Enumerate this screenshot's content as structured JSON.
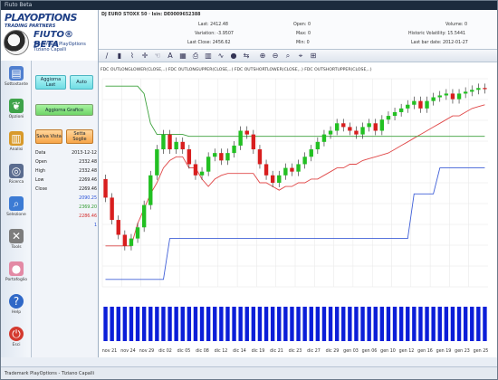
{
  "window": {
    "title": "Fiuto Beta"
  },
  "brand": {
    "line1": "PLAYOPTIONS",
    "line2": "TRADING PARTNERS",
    "line3": "FIUTO® BETA",
    "line4": "Trademark PlayOptions",
    "line5": "Tiziano Capalli"
  },
  "sidebar": {
    "items": [
      {
        "label": "Sottostante",
        "icon": "chart-bars-icon",
        "color": "#4f7fcf"
      },
      {
        "label": "Opzioni",
        "icon": "leaf-icon",
        "color": "#3ea34a"
      },
      {
        "label": "Analisi",
        "icon": "bar-chart-icon",
        "color": "#d89a2a"
      },
      {
        "label": "Ricerca",
        "icon": "binoculars-icon",
        "color": "#5a6c8f"
      },
      {
        "label": "Selezione",
        "icon": "magnifier-icon",
        "color": "#3c7bd4"
      },
      {
        "label": "Tools",
        "icon": "tools-icon",
        "color": "#7d7d7d"
      },
      {
        "label": "Portafoglio",
        "icon": "piggy-bank-icon",
        "color": "#e38aa5"
      },
      {
        "label": "Help",
        "icon": "help-icon",
        "color": "#2f68c7"
      },
      {
        "label": "Esci",
        "icon": "exit-icon",
        "color": "#d43a2f"
      }
    ]
  },
  "panel": {
    "btn_aggiorna_last": "Aggiorna Last",
    "btn_auto": "Auto",
    "btn_aggiorna_grafico": "Aggiorna Grafico",
    "btn_salva_vista": "Salva Vista",
    "btn_setta_soglie": "Setta Soglie",
    "stats": [
      {
        "label": "Data",
        "value": "2013-12-12",
        "color": "#222222"
      },
      {
        "label": "Open",
        "value": "2332.48",
        "color": "#222222"
      },
      {
        "label": "High",
        "value": "2332.48",
        "color": "#222222"
      },
      {
        "label": "Low",
        "value": "2269.46",
        "color": "#222222"
      },
      {
        "label": "Close",
        "value": "2269.46",
        "color": "#222222"
      },
      {
        "label": "",
        "value": "2090.25",
        "color": "#2850d8"
      },
      {
        "label": "",
        "value": "2369.20",
        "color": "#2e9a2e"
      },
      {
        "label": "",
        "value": "2286.46",
        "color": "#d42a2a"
      },
      {
        "label": "",
        "value": "1",
        "color": "#2850d8"
      }
    ]
  },
  "info": {
    "name": "DJ EURO STOXX 50 · Isin: DE0009652388",
    "last": "Last: 2412.48",
    "variation": "Variation: -3.9507",
    "last_close": "Last Close: 2456.62",
    "open": "Open: 0",
    "max": "Max: 0",
    "min": "Min: 0",
    "volume": "Volume: 0",
    "hist_vol": "Historic Volatility: 15.5441",
    "last_bar_date": "Last bar date: 2012-01-27"
  },
  "chart_data": {
    "type": "candlestick",
    "legend_text": "FDC OUTLONGLOWER(CLOSE,..) FDC OUTLONGUPPER(CLOSE,..) FDC OUTSHORTLOWER(CLOSE,..) FDC OUTSHORTUPPER(CLOSE,..)",
    "x_tick_labels": [
      "nov 21",
      "nov 24",
      "nov 29",
      "dic 02",
      "dic 05",
      "dic 08",
      "dic 12",
      "dic 14",
      "dic 19",
      "dic 21",
      "dic 23",
      "dic 27",
      "dic 29",
      "gen 03",
      "gen 06",
      "gen 10",
      "gen 12",
      "gen 16",
      "gen 19",
      "gen 23",
      "gen 25"
    ],
    "colors": {
      "up": "#22c022",
      "down": "#d81e1e",
      "volume": "#0b1ed8",
      "lower_band": "#4060d8",
      "upper_band": "#e04848",
      "green_line": "#3ca13c",
      "yellow_line": "#e8e04a"
    },
    "open": [
      2170,
      2120,
      2060,
      2020,
      1990,
      2010,
      2040,
      2100,
      2180,
      2250,
      2290,
      2250,
      2270,
      2250,
      2210,
      2180,
      2190,
      2230,
      2240,
      2220,
      2240,
      2260,
      2300,
      2290,
      2250,
      2210,
      2180,
      2160,
      2180,
      2200,
      2190,
      2210,
      2230,
      2250,
      2270,
      2290,
      2300,
      2320,
      2310,
      2300,
      2290,
      2310,
      2320,
      2300,
      2330,
      2340,
      2350,
      2360,
      2370,
      2380,
      2360,
      2380,
      2390,
      2395,
      2400,
      2385,
      2400,
      2405,
      2410,
      2415
    ],
    "close": [
      2120,
      2060,
      2020,
      1990,
      2010,
      2040,
      2100,
      2180,
      2250,
      2290,
      2250,
      2270,
      2250,
      2210,
      2180,
      2190,
      2230,
      2240,
      2220,
      2240,
      2260,
      2300,
      2290,
      2250,
      2210,
      2180,
      2160,
      2180,
      2200,
      2190,
      2210,
      2230,
      2250,
      2270,
      2290,
      2300,
      2320,
      2310,
      2300,
      2290,
      2310,
      2320,
      2300,
      2330,
      2340,
      2350,
      2360,
      2370,
      2380,
      2360,
      2380,
      2390,
      2395,
      2400,
      2385,
      2400,
      2405,
      2410,
      2415,
      2412
    ],
    "lower_band": [
      1900,
      1900,
      1900,
      1900,
      1900,
      1900,
      1900,
      1900,
      1900,
      1900,
      2010,
      2010,
      2010,
      2010,
      2010,
      2010,
      2010,
      2010,
      2010,
      2010,
      2010,
      2010,
      2010,
      2010,
      2010,
      2010,
      2010,
      2010,
      2010,
      2010,
      2010,
      2010,
      2010,
      2010,
      2010,
      2010,
      2010,
      2010,
      2010,
      2010,
      2010,
      2010,
      2010,
      2010,
      2010,
      2010,
      2010,
      2010,
      2130,
      2130,
      2130,
      2130,
      2200,
      2200,
      2200,
      2200,
      2200,
      2200,
      2200,
      2200
    ],
    "upper_band": [
      1990,
      1990,
      1990,
      1990,
      1990,
      2050,
      2090,
      2130,
      2160,
      2200,
      2220,
      2230,
      2230,
      2200,
      2200,
      2170,
      2150,
      2170,
      2180,
      2185,
      2185,
      2185,
      2185,
      2185,
      2160,
      2160,
      2150,
      2140,
      2150,
      2150,
      2160,
      2160,
      2170,
      2170,
      2180,
      2190,
      2200,
      2200,
      2210,
      2210,
      2220,
      2225,
      2230,
      2235,
      2240,
      2250,
      2260,
      2270,
      2280,
      2290,
      2300,
      2310,
      2320,
      2330,
      2340,
      2340,
      2350,
      2360,
      2365,
      2370
    ],
    "green_line": [
      2420,
      2420,
      2420,
      2420,
      2420,
      2420,
      2400,
      2320,
      2290,
      2290,
      2290,
      2290,
      2290,
      2285,
      2285,
      2285,
      2285,
      2285,
      2285,
      2285,
      2285,
      2285,
      2285,
      2285,
      2285,
      2285,
      2285,
      2285,
      2285,
      2285,
      2285,
      2285,
      2285,
      2285,
      2285,
      2285,
      2285,
      2285,
      2285,
      2285,
      2285,
      2285,
      2285,
      2285,
      2285,
      2285,
      2285,
      2285,
      2285,
      2285,
      2285,
      2285,
      2285,
      2285,
      2285,
      2285,
      2285,
      2285,
      2285,
      2285
    ],
    "volume": [
      1,
      1,
      1,
      1,
      1,
      1,
      1,
      1,
      1,
      1,
      1,
      1,
      1,
      1,
      1,
      1,
      1,
      1,
      1,
      1,
      1,
      1,
      1,
      1,
      1,
      1,
      1,
      1,
      1,
      1,
      1,
      1,
      1,
      1,
      1,
      1,
      1,
      1,
      1,
      1,
      1,
      1,
      1,
      1,
      1,
      1,
      1,
      1,
      1,
      1,
      1,
      1,
      1,
      1,
      1,
      1,
      1,
      1,
      1,
      1
    ]
  },
  "status": {
    "text": "Trademark PlayOptions - Tiziano Capalli"
  }
}
